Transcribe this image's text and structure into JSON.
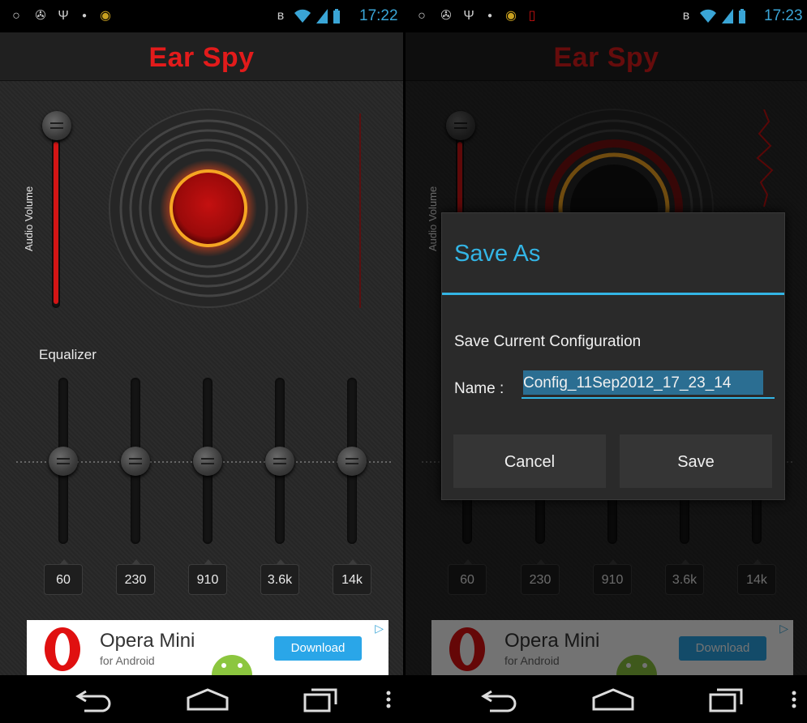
{
  "status_bar": {
    "left_time": "17:22",
    "right_time": "17:23",
    "icons": [
      "circle-icon",
      "android-icon",
      "usb-icon",
      "dot-icon",
      "app-icon",
      "bluetooth-icon",
      "wifi-icon",
      "signal-icon",
      "battery-icon"
    ]
  },
  "app": {
    "title": "Ear Spy",
    "accent_color": "#e21b1b",
    "volume_label": "Audio Volume",
    "volume_level": 1.0,
    "equalizer_label": "Equalizer",
    "bands": [
      {
        "label": "60",
        "level": 0.5
      },
      {
        "label": "230",
        "level": 0.5
      },
      {
        "label": "910",
        "level": 0.5
      },
      {
        "label": "3.6k",
        "level": 0.5
      },
      {
        "label": "14k",
        "level": 0.5
      }
    ]
  },
  "ad": {
    "title": "Opera Mini",
    "subtitle": "for Android",
    "button": "Download",
    "button_color": "#2aa6e8"
  },
  "dialog": {
    "title": "Save As",
    "message": "Save Current Configuration",
    "name_label": "Name :",
    "name_value": "Config_11Sep2012_17_23_14",
    "cancel": "Cancel",
    "save": "Save",
    "accent_color": "#33b5e5"
  },
  "nav": {
    "icons": [
      "back-icon",
      "home-icon",
      "recents-icon",
      "menu-icon"
    ]
  }
}
